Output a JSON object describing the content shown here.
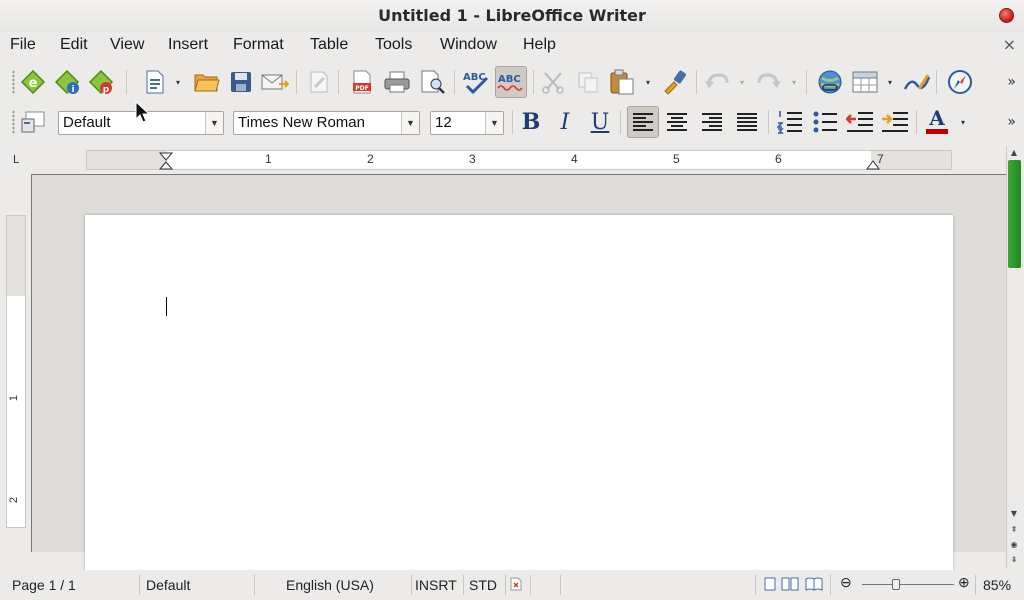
{
  "window": {
    "title": "Untitled 1 - LibreOffice Writer"
  },
  "menu": {
    "items": [
      {
        "label": "File"
      },
      {
        "label": "Edit"
      },
      {
        "label": "View"
      },
      {
        "label": "Insert"
      },
      {
        "label": "Format"
      },
      {
        "label": "Table"
      },
      {
        "label": "Tools"
      },
      {
        "label": "Window"
      },
      {
        "label": "Help"
      }
    ],
    "doc_close_icon": "×"
  },
  "formatting": {
    "paragraph_style": "Default",
    "font_name": "Times New Roman",
    "font_size": "12",
    "bold_glyph": "B",
    "italic_glyph": "I",
    "underline_glyph": "U",
    "font_color_glyph": "A"
  },
  "ruler": {
    "h_numbers": [
      "1",
      "2",
      "3",
      "4",
      "5",
      "6",
      "7"
    ],
    "v_numbers": [
      "1",
      "2"
    ],
    "corner_glyph": "L"
  },
  "statusbar": {
    "page": "Page 1 / 1",
    "style": "Default",
    "language": "English (USA)",
    "insert_mode": "INSRT",
    "selection_mode": "STD",
    "zoom": "85%",
    "zoom_minus": "⊖",
    "zoom_plus": "⊕"
  },
  "colors": {
    "accent_green": "#2a9a25",
    "font_color_red": "#c00000",
    "close_red": "#c21c12"
  },
  "icons": [
    "epub-export-icon",
    "epub-info-icon",
    "epub-pdf-icon",
    "new-document-icon",
    "open-folder-icon",
    "save-icon",
    "email-icon",
    "edit-file-icon",
    "export-pdf-icon",
    "print-icon",
    "print-preview-icon",
    "spellcheck-icon",
    "autospellcheck-icon",
    "cut-icon",
    "copy-icon",
    "paste-icon",
    "clone-formatting-icon",
    "undo-icon",
    "redo-icon",
    "hyperlink-icon",
    "table-icon",
    "draw-functions-icon",
    "navigator-icon",
    "styles-icon",
    "align-left-icon",
    "align-center-icon",
    "align-right-icon",
    "justify-icon",
    "numbering-icon",
    "bullets-icon",
    "decrease-indent-icon",
    "increase-indent-icon",
    "font-color-icon"
  ]
}
